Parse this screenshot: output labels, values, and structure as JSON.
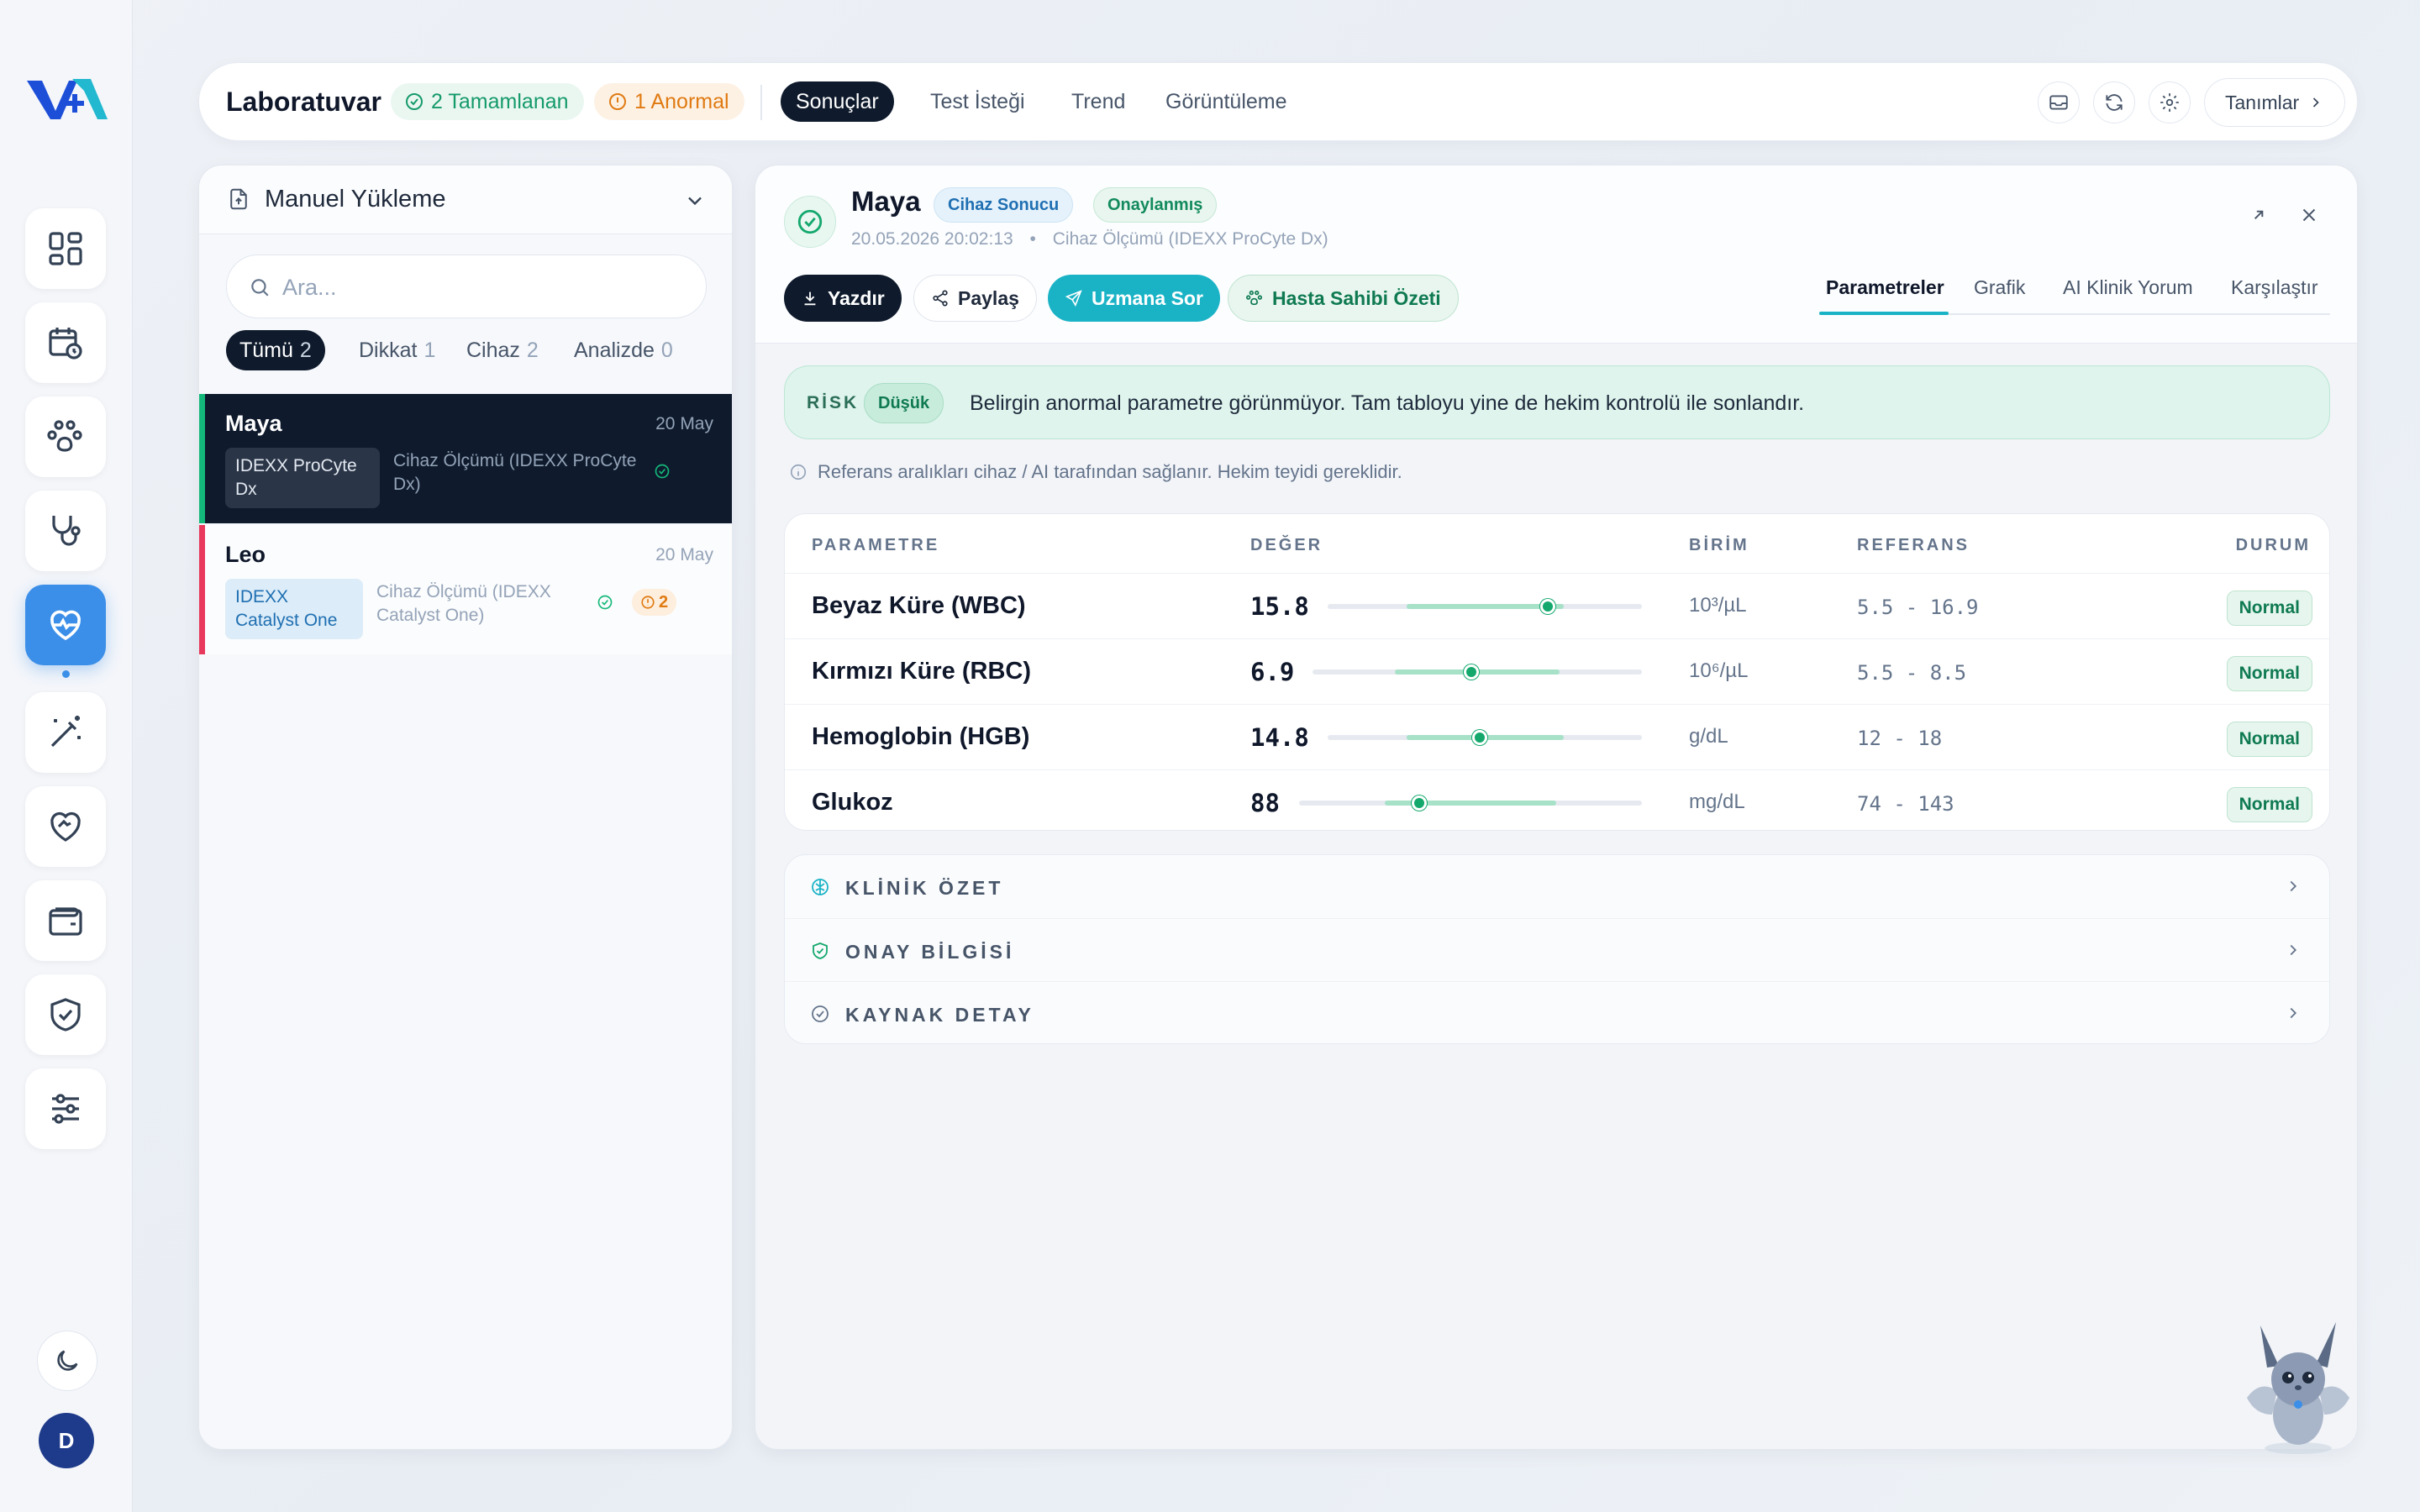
{
  "topbar": {
    "title": "Laboratuvar",
    "completed": "2 Tamamlanan",
    "abnormal": "1 Anormal",
    "tabs": [
      "Sonuçlar",
      "Test İsteği",
      "Trend",
      "Görüntüleme"
    ],
    "definitions": "Tanımlar"
  },
  "list": {
    "header": "Manuel Yükleme",
    "search_placeholder": "Ara...",
    "filters": [
      {
        "label": "Tümü",
        "count": "2"
      },
      {
        "label": "Dikkat",
        "count": "1"
      },
      {
        "label": "Cihaz",
        "count": "2"
      },
      {
        "label": "Analizde",
        "count": "0"
      }
    ],
    "items": [
      {
        "name": "Maya",
        "date": "20 May",
        "device_line1": "IDEXX ProCyte",
        "device_line2": "Dx",
        "desc_line1": "Cihaz Ölçümü (IDEXX ProCyte",
        "desc_line2": "Dx)"
      },
      {
        "name": "Leo",
        "date": "20 May",
        "device_line1": "IDEXX",
        "device_line2": "Catalyst One",
        "desc_line1": "Cihaz Ölçümü (IDEXX",
        "desc_line2": "Catalyst One)",
        "badge": "2"
      }
    ]
  },
  "detail": {
    "name": "Maya",
    "tag_source": "Cihaz Sonucu",
    "tag_status": "Onaylanmış",
    "datetime": "20.05.2026 20:02:13",
    "method": "Cihaz Ölçümü (IDEXX ProCyte Dx)",
    "buttons": {
      "print": "Yazdır",
      "share": "Paylaş",
      "ask": "Uzmana Sor",
      "owner": "Hasta Sahibi Özeti"
    },
    "tabs": [
      "Parametreler",
      "Grafik",
      "AI Klinik Yorum",
      "Karşılaştır"
    ],
    "risk": {
      "label": "RİSK",
      "level": "Düşük",
      "text": "Belirgin anormal parametre görünmüyor. Tam tabloyu yine de hekim kontrolü ile sonlandır."
    },
    "note": "Referans aralıkları cihaz / AI tarafından sağlanır. Hekim teyidi gereklidir.",
    "table": {
      "headers": [
        "PARAMETRE",
        "DEĞER",
        "BİRİM",
        "REFERANS",
        "DURUM"
      ],
      "rows": [
        {
          "name": "Beyaz Küre (WBC)",
          "value": "15.8",
          "unit": "10³/µL",
          "ref": "5.5 - 16.9",
          "status": "Normal",
          "num": 15.8,
          "min": 5.5,
          "max": 16.9
        },
        {
          "name": "Kırmızı Küre (RBC)",
          "value": "6.9",
          "unit": "10⁶/µL",
          "ref": "5.5 - 8.5",
          "status": "Normal",
          "num": 6.9,
          "min": 5.5,
          "max": 8.5
        },
        {
          "name": "Hemoglobin (HGB)",
          "value": "14.8",
          "unit": "g/dL",
          "ref": "12 - 18",
          "status": "Normal",
          "num": 14.8,
          "min": 12,
          "max": 18
        },
        {
          "name": "Glukoz",
          "value": "88",
          "unit": "mg/dL",
          "ref": "74 - 143",
          "status": "Normal",
          "num": 88,
          "min": 74,
          "max": 143
        }
      ]
    },
    "sections": [
      "KLİNİK ÖZET",
      "ONAY BİLGİSİ",
      "KAYNAK DETAY"
    ]
  },
  "user": {
    "initial": "D"
  },
  "colors": {
    "accent": "#1ab3c6",
    "primary": "#3b8fe8",
    "dark": "#0f1b2d",
    "ok": "#14a86d",
    "warn": "#e07a12",
    "alert": "#e8385c"
  }
}
